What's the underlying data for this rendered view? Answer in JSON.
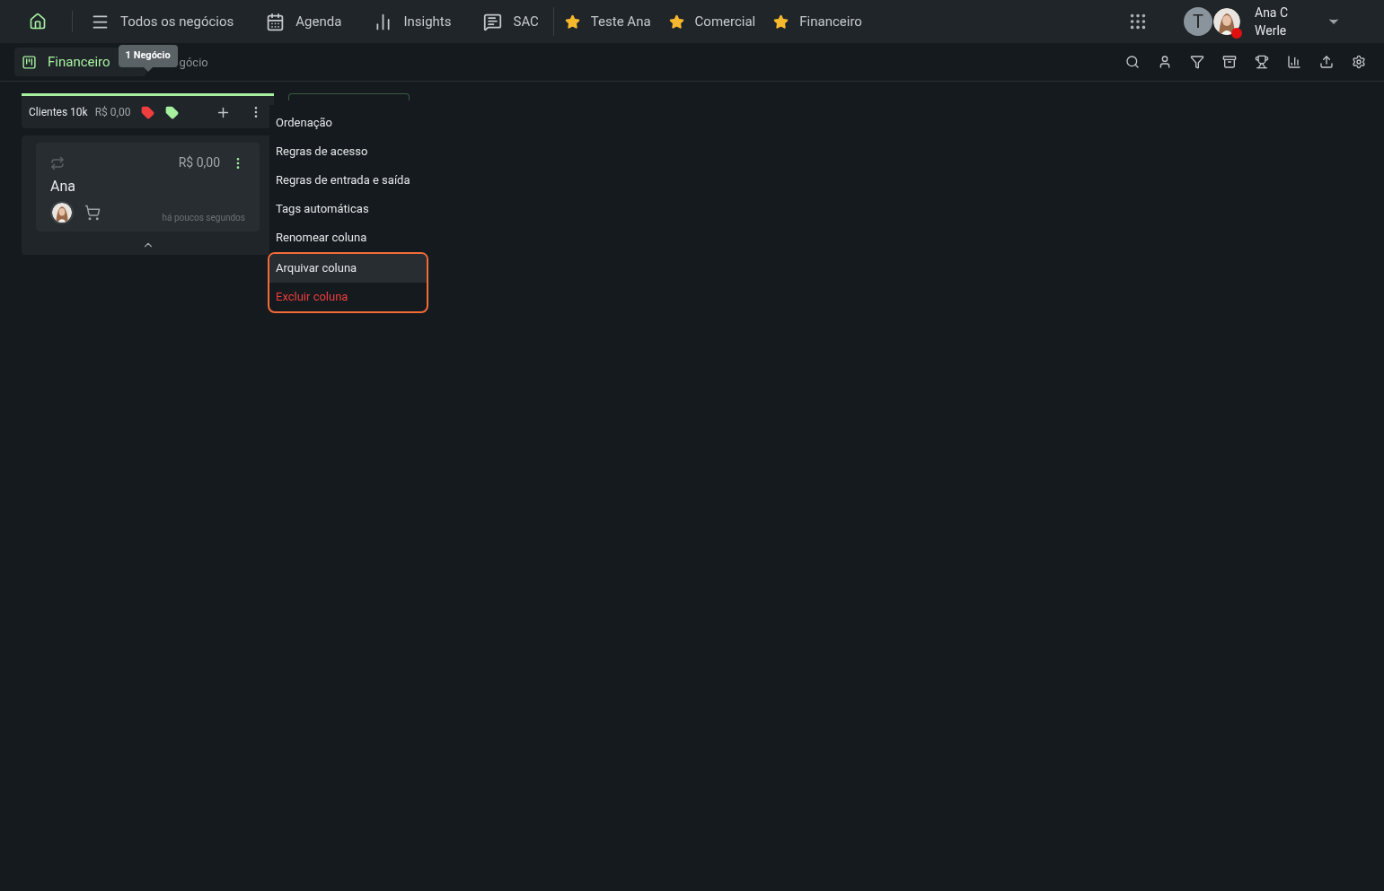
{
  "nav": [
    {
      "kind": "home"
    },
    {
      "kind": "link",
      "label": "Todos os negócios"
    },
    {
      "kind": "link",
      "label": "Agenda"
    },
    {
      "kind": "link",
      "label": "Insights"
    },
    {
      "kind": "link",
      "label": "SAC"
    },
    {
      "kind": "favorite",
      "label": "Teste Ana"
    },
    {
      "kind": "favorite",
      "label": "Comercial"
    },
    {
      "kind": "favorite",
      "label": "Financeiro"
    }
  ],
  "user": {
    "initial": "T",
    "name_line_1": "Ana C",
    "name_line_2": "Werle",
    "online": false
  },
  "board_tab": {
    "label": "Financeiro",
    "selected": true
  },
  "breadcrumb_rest": "gócio",
  "tooltip": "1 Negócio",
  "column": {
    "title": "Clientes 10k",
    "total": "R$ 0,00",
    "tags": [
      {
        "color": "#f03e3e"
      },
      {
        "color": "#a6f0a0"
      }
    ]
  },
  "card": {
    "value": "R$ 0,00",
    "name": "Ana",
    "time": "há poucos segundos"
  },
  "menu": [
    {
      "label": "Ordenação",
      "kind": "normal",
      "selected": false,
      "annotated": false
    },
    {
      "label": "Regras de acesso",
      "kind": "normal",
      "selected": false,
      "annotated": false
    },
    {
      "label": "Regras de entrada e saída",
      "kind": "normal",
      "selected": false,
      "annotated": false
    },
    {
      "label": "Tags automáticas",
      "kind": "normal",
      "selected": false,
      "annotated": false
    },
    {
      "label": "Renomear coluna",
      "kind": "normal",
      "selected": false,
      "annotated": false
    },
    {
      "label": "Arquivar coluna",
      "kind": "normal",
      "selected": true,
      "annotated": true
    },
    {
      "label": "Excluir coluna",
      "kind": "danger",
      "selected": false,
      "annotated": true
    }
  ]
}
